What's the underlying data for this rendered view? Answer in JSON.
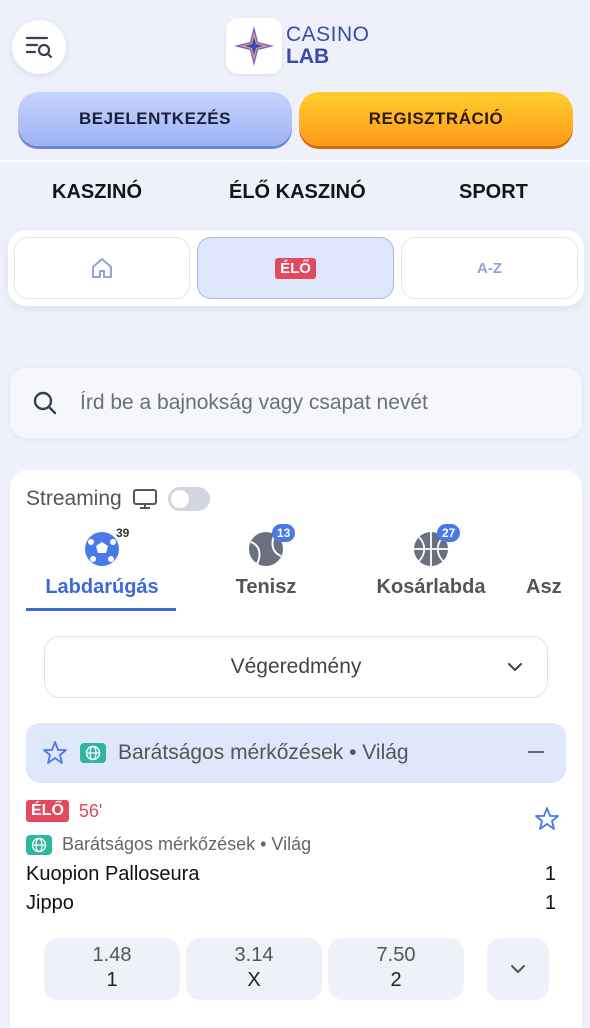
{
  "header": {
    "logo_line1": "CASINO",
    "logo_line2": "LAB",
    "login_label": "BEJELENTKEZÉS",
    "register_label": "REGISZTRÁCIÓ"
  },
  "main_nav": [
    "KASZINÓ",
    "ÉLŐ KASZINÓ",
    "SPORT"
  ],
  "subtabs": {
    "home_icon": "home-icon",
    "live_label": "ÉLŐ",
    "az_label": "A-Z"
  },
  "search": {
    "placeholder": "Írd be a bajnokság vagy csapat nevét"
  },
  "streaming": {
    "label": "Streaming",
    "enabled": false
  },
  "sports": [
    {
      "label": "Labdarúgás",
      "count": "39",
      "icon": "soccer-ball-icon",
      "active": true
    },
    {
      "label": "Tenisz",
      "count": "13",
      "icon": "tennis-ball-icon",
      "active": false
    },
    {
      "label": "Kosárlabda",
      "count": "27",
      "icon": "basketball-icon",
      "active": false
    },
    {
      "label": "Asz",
      "count": "",
      "icon": "",
      "active": false
    }
  ],
  "market_select": {
    "value": "Végeredmény"
  },
  "league": {
    "title": "Barátságos mérkőzések • Világ"
  },
  "match": {
    "live_label": "ÉLŐ",
    "minute": "56'",
    "competition": "Barátságos mérkőzések • Világ",
    "home_team": "Kuopion Palloseura",
    "home_score": "1",
    "away_team": "Jippo",
    "away_score": "1",
    "odds": [
      {
        "price": "1.48",
        "label": "1"
      },
      {
        "price": "3.14",
        "label": "X"
      },
      {
        "price": "7.50",
        "label": "2"
      }
    ]
  },
  "colors": {
    "accent_blue": "#3c6ad8",
    "live_red": "#e24a60",
    "register_orange": "#ff9a1a",
    "login_blue": "#9fb3f4"
  }
}
